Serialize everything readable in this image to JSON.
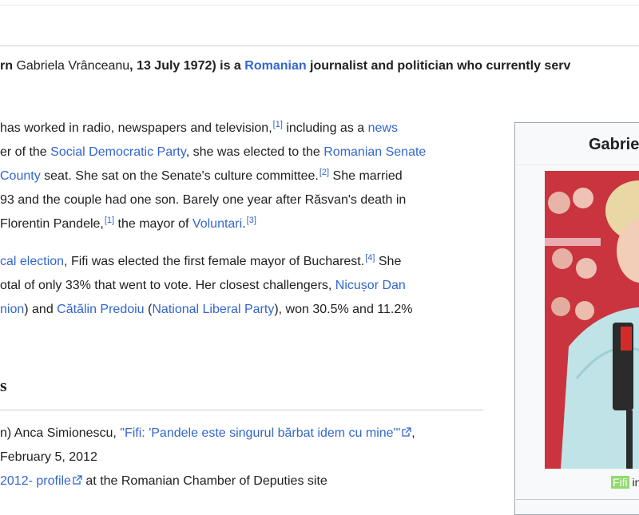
{
  "lead": {
    "seg1": "rn ",
    "seg2": "Gabriela Vrânceanu",
    "seg3": ", 13 July 1972) is a ",
    "seg4_link": "Romanian",
    "seg5": " journalist and politician who currently serv"
  },
  "p1": {
    "l1a": " has worked in radio, newspapers and television,",
    "l1ref": "[1]",
    "l1b": " including as a ",
    "l1link": "news",
    "l2a": "er of the ",
    "l2link1": "Social Democratic Party",
    "l2b": ", she was elected to the ",
    "l2link2": "Romanian Senate",
    "l3link": "County",
    "l3a": " seat. She sat on the Senate's culture committee.",
    "l3ref": "[2]",
    "l3b": " She married",
    "l4": "93 and the couple had one son. Barely one year after Răsvan's death in",
    "l5a": "Florentin Pandele,",
    "l5ref": "[1]",
    "l5b": " the mayor of ",
    "l5link": "Voluntari",
    "l5c": ".",
    "l5ref2": "[3]"
  },
  "p2": {
    "l1link": "cal election",
    "l1a": ", Fifi was elected the first female mayor of Bucharest.",
    "l1ref": "[4]",
    "l1b": " She",
    "l2a": "otal of only 33% that went to vote. Her closest challengers, ",
    "l2link": "Nicușor Dan",
    "l3link1": "nion",
    "l3a": ") and ",
    "l3link2": "Cătălin Predoiu",
    "l3b": " (",
    "l3link3": "National Liberal Party",
    "l3c": "), won 30.5% and 11.2%"
  },
  "section_heading": "s",
  "refs": {
    "r1a": "n) Anca Simionescu, ",
    "r1link": "\"Fifi: 'Pandele este singurul bărbat idem cu mine'\"",
    "r1b": ",",
    "r2": "February 5, 2012",
    "r3link": "2012- profile",
    "r3a": " at the Romanian Chamber of Deputies site"
  },
  "infobox": {
    "title": "Gabrie",
    "caption_highlight": "Fifi",
    "caption_rest": " in"
  },
  "colors": {
    "link": "#3366cc",
    "text": "#202122",
    "photo_bg": "#d9414b",
    "caption_highlight": "#8fdc6b"
  },
  "icons": {
    "external_link": "external-link-icon"
  }
}
